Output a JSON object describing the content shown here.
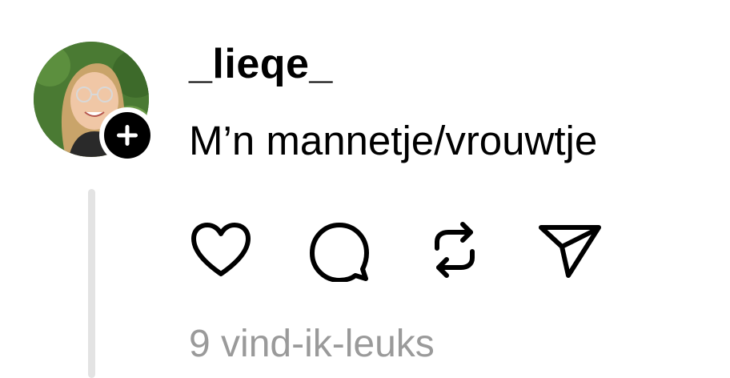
{
  "post": {
    "username": "_lieqe_",
    "text": "M’n mannetje/vrouwtje",
    "likes_label": "9 vind-ik-leuks"
  },
  "icons": {
    "avatar": "user-avatar-photo",
    "follow": "plus-icon",
    "like": "heart-outline-icon",
    "comment": "speech-bubble-icon",
    "repost": "repost-arrows-icon",
    "share": "paper-plane-icon"
  },
  "colors": {
    "text": "#000000",
    "secondary_text": "#9a9a9a",
    "thread_line": "#e3e3e3",
    "badge": "#000000"
  }
}
